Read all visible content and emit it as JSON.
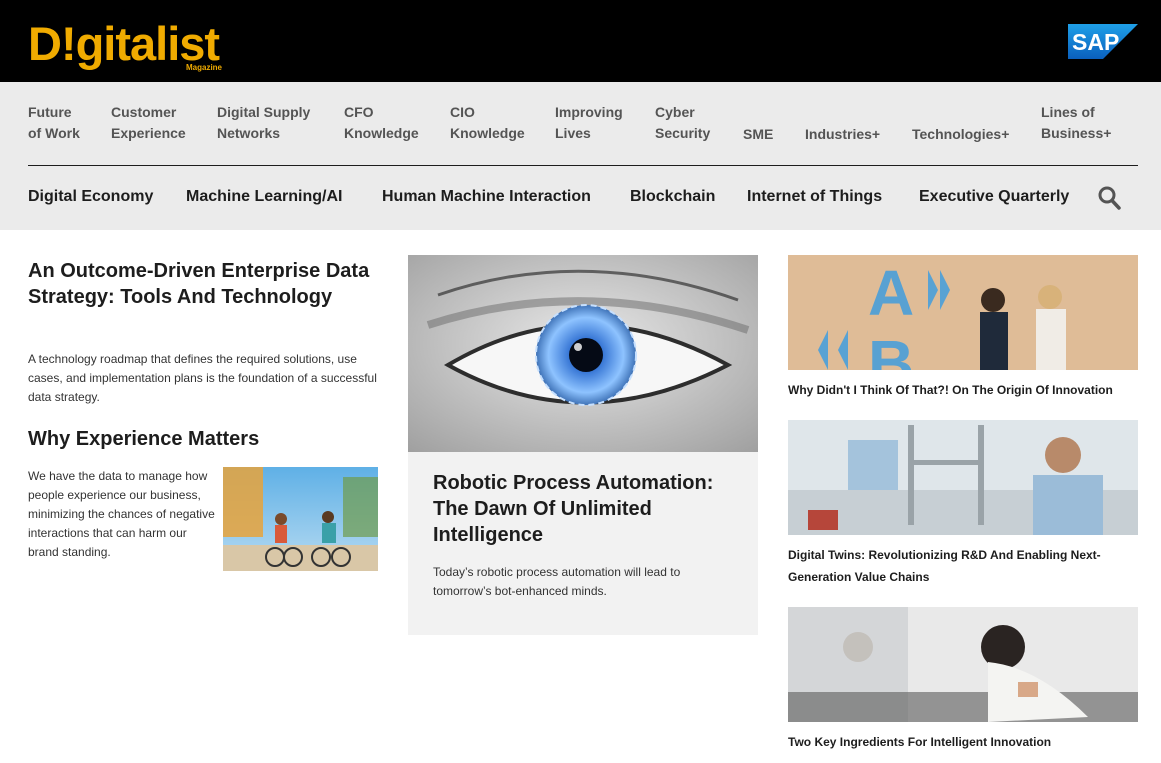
{
  "header": {
    "logo_text": "D!gitalist",
    "logo_sub": "Magazine",
    "sap_logo": "SAP"
  },
  "nav_primary": [
    {
      "line1": "Future",
      "line2": "of Work"
    },
    {
      "line1": "Customer",
      "line2": "Experience"
    },
    {
      "line1": "Digital Supply",
      "line2": "Networks"
    },
    {
      "line1": "CFO",
      "line2": "Knowledge"
    },
    {
      "line1": "CIO",
      "line2": "Knowledge"
    },
    {
      "line1": "Improving",
      "line2": "Lives"
    },
    {
      "line1": "Cyber",
      "line2": "Security"
    },
    {
      "line1": "SME",
      "line2": ""
    },
    {
      "line1": "Industries+",
      "line2": ""
    },
    {
      "line1": "Technologies+",
      "line2": ""
    },
    {
      "line1": "Lines of",
      "line2": "Business+"
    }
  ],
  "nav_secondary": [
    "Digital Economy",
    "Machine Learning/AI",
    "Human Machine Interaction",
    "Blockchain",
    "Internet of Things",
    "Executive Quarterly"
  ],
  "search_icon": "search-icon",
  "articles": {
    "lead": {
      "title": "An Outcome-Driven Enterprise Data Strategy: Tools And Technology",
      "desc": "A technology roadmap that defines the required solutions, use cases, and implementation plans is the foundation of a successful data strategy."
    },
    "experience": {
      "title": "Why Experience Matters",
      "desc": "We have the data to manage how people experience our business, minimizing the chances of negative interactions that can harm our brand standing."
    },
    "center": {
      "title": "Robotic Process Automation: The Dawn Of Unlimited Intelligence",
      "desc": "Today’s robotic process automation will lead to tomorrow’s bot-enhanced minds."
    },
    "side": [
      {
        "title": "Why Didn't I Think Of That?! On The Origin Of Innovation"
      },
      {
        "title": "Digital Twins: Revolutionizing R&D And Enabling Next-Generation Value Chains"
      },
      {
        "title": "Two Key Ingredients For Intelligent Innovation"
      }
    ]
  },
  "colors": {
    "brand_yellow": "#f0ab00",
    "sap_blue": "#0a6ed1",
    "header_bg": "#000000",
    "nav_bg": "#ebebeb"
  }
}
